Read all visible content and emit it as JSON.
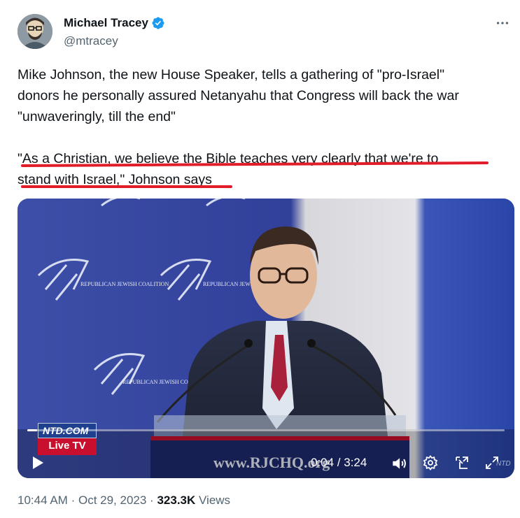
{
  "author": {
    "display_name": "Michael Tracey",
    "handle": "@mtracey",
    "verified_icon": "verified-badge-icon",
    "avatar_icon": "avatar-illustration"
  },
  "more_icon": "more-horizontal-icon",
  "tweet": {
    "paragraph_1": "Mike Johnson, the new House Speaker, tells a gathering of \"pro-Israel\"\ndonors he personally assured Netanyahu that Congress will back the war\n\"unwaveringly, till the end\"",
    "paragraph_2": "\"As a Christian, we believe the Bible teaches very clearly that we're to\nstand with Israel,\" Johnson says"
  },
  "video": {
    "backdrop_text": "REPUBLICAN JEWISH COALITION",
    "podium_url": "www.RJCHQ.org",
    "badge_top": "NTD.COM",
    "badge_bottom": "Live TV",
    "watermark": "NTD",
    "time": "0:04 / 3:24",
    "progress_fraction": 0.02,
    "icons": [
      "play-icon",
      "volume-icon",
      "settings-icon",
      "picture-in-picture-icon",
      "fullscreen-icon"
    ]
  },
  "meta": {
    "time": "10:44 AM",
    "date": "Oct 29, 2023",
    "separator": "·",
    "views_count": "323.3K",
    "views_label": "Views"
  },
  "colors": {
    "underline": "#e11d2a",
    "verified": "#1d9bf0",
    "secondary_text": "#536471",
    "primary_text": "#0f1419"
  }
}
